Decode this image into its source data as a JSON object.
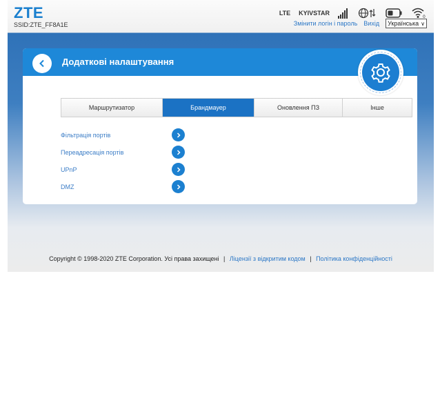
{
  "header": {
    "logo": "ZTE",
    "ssid": "SSID:ZTE_FF8A1E",
    "network_type": "LTE",
    "operator": "KYIVSTAR",
    "signal_bars": 5,
    "change_login_link": "Змінити логін і пароль",
    "logout_link": "Вихід",
    "language_selected": "Українська"
  },
  "card": {
    "title": "Додаткові налаштування"
  },
  "tabs": [
    {
      "label": "Маршрутизатор",
      "active": false
    },
    {
      "label": "Брандмауер",
      "active": true
    },
    {
      "label": "Оновлення ПЗ",
      "active": false
    },
    {
      "label": "Інше",
      "active": false
    }
  ],
  "menu": [
    {
      "label": "Фільтрація портів"
    },
    {
      "label": "Переадресація портів"
    },
    {
      "label": "UPnP"
    },
    {
      "label": "DMZ"
    }
  ],
  "footer": {
    "copyright": "Copyright © 1998-2020 ZTE Corporation. Усі права захищені",
    "open_source_link": "Ліцензії з відкритим кодом",
    "privacy_link": "Політика конфіденційності",
    "separator": "|"
  },
  "colors": {
    "brand_blue": "#1e88d8",
    "active_tab": "#1b72c4",
    "link": "#2b77c6"
  },
  "icons": {
    "back": "chevron-left-icon",
    "settings": "gear-icon",
    "menu_arrow": "chevron-right-icon",
    "signal": "signal-bars-icon",
    "data": "globe-data-icon",
    "battery": "battery-icon",
    "wifi": "wifi-icon"
  }
}
